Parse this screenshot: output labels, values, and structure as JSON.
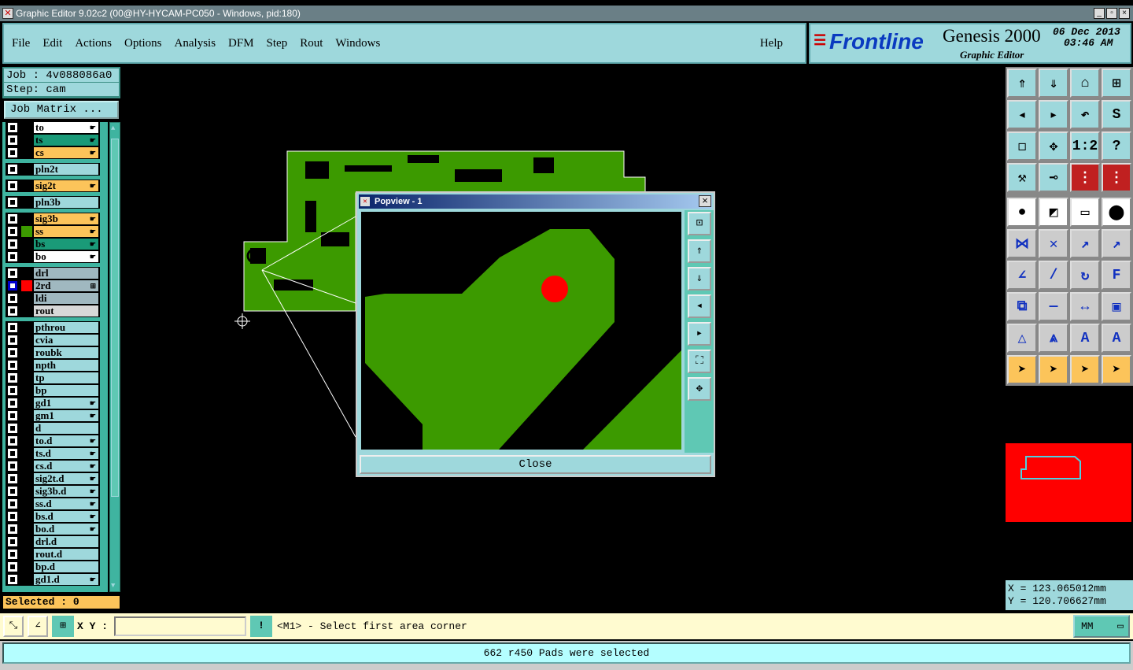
{
  "window": {
    "title": "Graphic Editor 9.02c2 (00@HY-HYCAM-PC050 - Windows, pid:180)",
    "minimize": "_",
    "restore": "▫",
    "close": "×"
  },
  "menu": {
    "items": [
      "File",
      "Edit",
      "Actions",
      "Options",
      "Analysis",
      "DFM",
      "Step",
      "Rout",
      "Windows"
    ],
    "help": "Help"
  },
  "brand": {
    "logo": "Frontline",
    "product": "Genesis 2000",
    "subtitle": "Graphic Editor",
    "date": "06 Dec 2013",
    "time": "03:46 AM"
  },
  "job": {
    "job_label": "Job  :  4v088086a0",
    "step_label": "Step:  cam",
    "matrix_button": "Job Matrix ..."
  },
  "layers": [
    {
      "name": "to",
      "color": "#ffffff",
      "arrow": true
    },
    {
      "name": "ts",
      "color": "#1a9a78",
      "arrow": true
    },
    {
      "name": "cs",
      "color": "#fcc45a",
      "arrow": true
    },
    {
      "name": "pln2t",
      "color": "#9ed8dc",
      "arrow": false
    },
    {
      "name": "sig2t",
      "color": "#fcc45a",
      "arrow": true
    },
    {
      "name": "pln3b",
      "color": "#9ed8dc",
      "arrow": false
    },
    {
      "name": "sig3b",
      "color": "#fcc45a",
      "arrow": true
    },
    {
      "name": "ss",
      "color": "#fcc45a",
      "arrow": true,
      "swatch": "#3c9a00"
    },
    {
      "name": "bs",
      "color": "#1a9a78",
      "arrow": true
    },
    {
      "name": "bo",
      "color": "#ffffff",
      "arrow": true
    },
    {
      "name": "drl",
      "color": "#a0b8c0",
      "arrow": false
    },
    {
      "name": "2rd",
      "color": "#a0b8c0",
      "arrow": false,
      "swatch": "#ff0000",
      "work": true
    },
    {
      "name": "ldi",
      "color": "#a0b8c0",
      "arrow": false
    },
    {
      "name": "rout",
      "color": "#d8d8d8",
      "arrow": false
    },
    {
      "name": "pthrou",
      "color": "#9ed8dc",
      "arrow": false
    },
    {
      "name": "cvia",
      "color": "#9ed8dc",
      "arrow": false
    },
    {
      "name": "roubk",
      "color": "#9ed8dc",
      "arrow": false
    },
    {
      "name": "npth",
      "color": "#9ed8dc",
      "arrow": false
    },
    {
      "name": "tp",
      "color": "#9ed8dc",
      "arrow": false
    },
    {
      "name": "bp",
      "color": "#9ed8dc",
      "arrow": false
    },
    {
      "name": "gd1",
      "color": "#9ed8dc",
      "arrow": true
    },
    {
      "name": "gm1",
      "color": "#9ed8dc",
      "arrow": true
    },
    {
      "name": "d",
      "color": "#9ed8dc",
      "arrow": false
    },
    {
      "name": "to.d",
      "color": "#9ed8dc",
      "arrow": true
    },
    {
      "name": "ts.d",
      "color": "#9ed8dc",
      "arrow": true
    },
    {
      "name": "cs.d",
      "color": "#9ed8dc",
      "arrow": true
    },
    {
      "name": "sig2t.d",
      "color": "#9ed8dc",
      "arrow": true
    },
    {
      "name": "sig3b.d",
      "color": "#9ed8dc",
      "arrow": true
    },
    {
      "name": "ss.d",
      "color": "#9ed8dc",
      "arrow": true
    },
    {
      "name": "bs.d",
      "color": "#9ed8dc",
      "arrow": true
    },
    {
      "name": "bo.d",
      "color": "#9ed8dc",
      "arrow": true
    },
    {
      "name": "drl.d",
      "color": "#9ed8dc",
      "arrow": false
    },
    {
      "name": "rout.d",
      "color": "#9ed8dc",
      "arrow": false
    },
    {
      "name": "bp.d",
      "color": "#9ed8dc",
      "arrow": false
    },
    {
      "name": "gd1.d",
      "color": "#9ed8dc",
      "arrow": true
    }
  ],
  "selected": "Selected : 0",
  "tools": [
    {
      "icon": "zoom-up-icon",
      "g": "⇑",
      "bg": "#9ed8dc"
    },
    {
      "icon": "zoom-down-icon",
      "g": "⇓",
      "bg": "#9ed8dc"
    },
    {
      "icon": "home-icon",
      "g": "⌂",
      "bg": "#9ed8dc"
    },
    {
      "icon": "grid-xy-icon",
      "g": "⊞",
      "bg": "#9ed8dc"
    },
    {
      "icon": "pan-left-icon",
      "g": "◂",
      "bg": "#9ed8dc"
    },
    {
      "icon": "pan-right-icon",
      "g": "▸",
      "bg": "#9ed8dc"
    },
    {
      "icon": "undo-view-icon",
      "g": "↶",
      "bg": "#9ed8dc"
    },
    {
      "icon": "snake-icon",
      "g": "S",
      "bg": "#9ed8dc"
    },
    {
      "icon": "zoom-fit-icon",
      "g": "◻",
      "bg": "#9ed8dc"
    },
    {
      "icon": "zoom-center-icon",
      "g": "✥",
      "bg": "#9ed8dc"
    },
    {
      "icon": "scale-1-2-icon",
      "g": "1:2",
      "bg": "#9ed8dc"
    },
    {
      "icon": "help-icon",
      "g": "?",
      "bg": "#9ed8dc"
    },
    {
      "icon": "tools-icon",
      "g": "⚒",
      "bg": "#9ed8dc"
    },
    {
      "icon": "snap-icon",
      "g": "⊸",
      "bg": "#9ed8dc"
    },
    {
      "icon": "netlist-icon",
      "g": "⋮",
      "bg": "#c02020"
    },
    {
      "icon": "netlist-2-icon",
      "g": "⋮",
      "bg": "#c02020"
    },
    {
      "icon": "select-pad-icon",
      "g": "●",
      "bg": "#fff"
    },
    {
      "icon": "measure-icon",
      "g": "◩",
      "bg": "#fff"
    },
    {
      "icon": "ruler-icon",
      "g": "▭",
      "bg": "#fff"
    },
    {
      "icon": "pad-icon",
      "g": "⬤",
      "bg": "#fff"
    },
    {
      "icon": "connect-pads-icon",
      "g": "⋈",
      "bg": "#ccc"
    },
    {
      "icon": "delete-pad-icon",
      "g": "✕",
      "bg": "#ccc"
    },
    {
      "icon": "move-pad-icon",
      "g": "↗",
      "bg": "#ccc"
    },
    {
      "icon": "move-pad-2-icon",
      "g": "↗",
      "bg": "#ccc"
    },
    {
      "icon": "line-angle-icon",
      "g": "∠",
      "bg": "#ccc"
    },
    {
      "icon": "line-icon",
      "g": "/",
      "bg": "#ccc"
    },
    {
      "icon": "rotate-icon",
      "g": "↻",
      "bg": "#ccc"
    },
    {
      "icon": "mirror-icon",
      "g": "F",
      "bg": "#ccc"
    },
    {
      "icon": "copy-icon",
      "g": "⧉",
      "bg": "#ccc"
    },
    {
      "icon": "segment-icon",
      "g": "—",
      "bg": "#ccc"
    },
    {
      "icon": "dimension-icon",
      "g": "↔",
      "bg": "#ccc"
    },
    {
      "icon": "shapes-icon",
      "g": "▣",
      "bg": "#ccc"
    },
    {
      "icon": "triangle-icon",
      "g": "△",
      "bg": "#ccc"
    },
    {
      "icon": "triangle-up-icon",
      "g": "⩓",
      "bg": "#ccc"
    },
    {
      "icon": "arc-icon",
      "g": "A",
      "bg": "#ccc"
    },
    {
      "icon": "arc-cross-icon",
      "g": "A",
      "bg": "#ccc"
    },
    {
      "icon": "pointer-icon",
      "g": "➤",
      "bg": "#fcc45a"
    },
    {
      "icon": "select-rect-icon",
      "g": "➤",
      "bg": "#fcc45a"
    },
    {
      "icon": "select-poly-icon",
      "g": "➤",
      "bg": "#fcc45a"
    },
    {
      "icon": "select-net-icon",
      "g": "➤",
      "bg": "#fcc45a"
    }
  ],
  "coords": {
    "x": "X  =  123.065012mm",
    "y": "Y  =  120.706627mm"
  },
  "cmd": {
    "xy_label": "X Y :",
    "xy_value": "",
    "prompt": "<M1> - Select first area corner",
    "units": "MM"
  },
  "status": "662 r450 Pads were selected",
  "popview": {
    "title": "Popview - 1",
    "close": "Close",
    "pcb_color": "#3c9a00",
    "pad_color": "#ff0000"
  }
}
